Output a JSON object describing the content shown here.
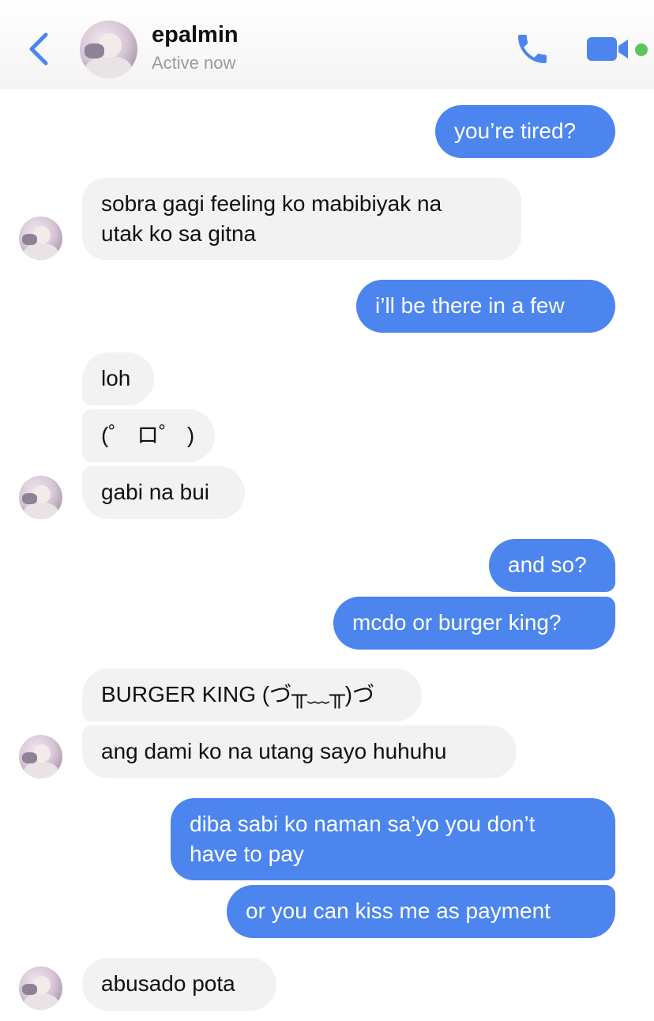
{
  "header": {
    "contact_name": "epalmin",
    "status": "Active now",
    "colors": {
      "accent": "#4c85ee",
      "online": "#5ac55a"
    },
    "icons": [
      "back-chevron-icon",
      "phone-icon",
      "video-camera-icon"
    ]
  },
  "messages": [
    {
      "from": "me",
      "text": "you’re tired?"
    },
    {
      "from": "contact",
      "lines": [
        "sobra gagi feeling ko mabibiyak na",
        "utak ko sa gitna"
      ]
    },
    {
      "from": "me",
      "text": "i’ll be there in a few"
    },
    {
      "from": "contact",
      "text": "loh"
    },
    {
      "from": "contact",
      "text": "(゜ ロ゜ )"
    },
    {
      "from": "contact",
      "text": "gabi na bui"
    },
    {
      "from": "me",
      "text": "and so?"
    },
    {
      "from": "me",
      "text": "mcdo or burger king?"
    },
    {
      "from": "contact",
      "text": "BURGER KING (づ╥﹏╥)づ"
    },
    {
      "from": "contact",
      "text": "ang dami ko na utang sayo huhuhu"
    },
    {
      "from": "me",
      "lines": [
        "diba sabi ko naman sa’yo you don’t",
        "have to pay"
      ]
    },
    {
      "from": "me",
      "text": "or you can kiss me as payment"
    },
    {
      "from": "contact",
      "text": "abusado pota"
    }
  ]
}
